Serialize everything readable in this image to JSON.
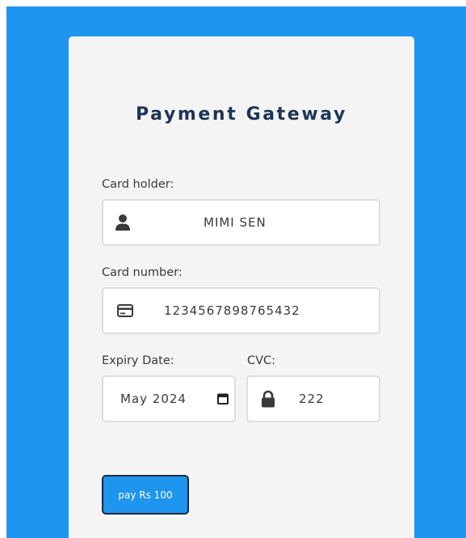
{
  "form": {
    "title": "Payment Gateway",
    "card_holder": {
      "label": "Card holder:",
      "value": "MIMI SEN",
      "icon": "user-icon"
    },
    "card_number": {
      "label": "Card number:",
      "value": "1234567898765432",
      "icon": "credit-card-icon"
    },
    "expiry": {
      "label": "Expiry Date:",
      "value": "May 2024",
      "icon": "calendar-icon"
    },
    "cvc": {
      "label": "CVC:",
      "value": "222",
      "icon": "lock-icon"
    },
    "pay_button": {
      "label": "pay Rs 100"
    }
  },
  "colors": {
    "background": "#1e95ee",
    "card": "#f4f4f4",
    "title": "#1d3557",
    "button": "#1e95ee"
  }
}
